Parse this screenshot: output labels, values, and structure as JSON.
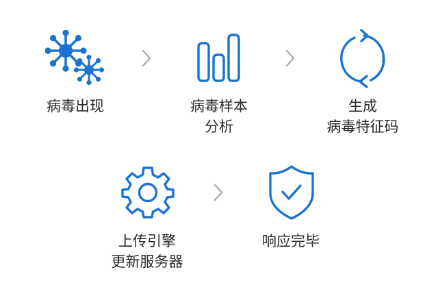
{
  "colors": {
    "icon_blue": "#1a73d0",
    "arrow_gray": "#a8a8a8",
    "text": "#2b2b2b",
    "background": "#ffffff"
  },
  "steps": [
    {
      "icon": "virus-icon",
      "line1": "病毒出现",
      "line2": ""
    },
    {
      "icon": "bar-chart-icon",
      "line1": "病毒样本",
      "line2": "分析"
    },
    {
      "icon": "refresh-cycle-icon",
      "line1": "生成",
      "line2": "病毒特征码"
    },
    {
      "icon": "gear-icon",
      "line1": "上传引擎",
      "line2": "更新服务器"
    },
    {
      "icon": "shield-check-icon",
      "line1": "响应完毕",
      "line2": ""
    }
  ]
}
